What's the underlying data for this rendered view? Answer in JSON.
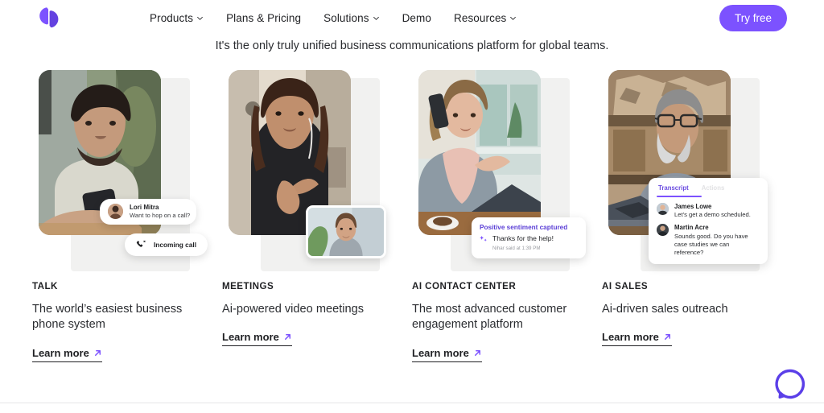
{
  "header": {
    "logo_name": "dialpad-logo",
    "nav": [
      {
        "label": "Products",
        "has_chevron": true
      },
      {
        "label": "Plans & Pricing",
        "has_chevron": false
      },
      {
        "label": "Solutions",
        "has_chevron": true
      },
      {
        "label": "Demo",
        "has_chevron": false
      },
      {
        "label": "Resources",
        "has_chevron": true
      }
    ],
    "cta_label": "Try free",
    "cta_color": "#7c52ff"
  },
  "tagline": "It's the only truly unified business communications platform for global teams.",
  "cards": [
    {
      "eyebrow": "TALK",
      "description": "The world’s easiest business phone system",
      "link_label": "Learn more",
      "overlay": {
        "message_name": "Lori Mitra",
        "message_text": "Want to hop on a call?",
        "call_label": "Incoming call"
      }
    },
    {
      "eyebrow": "MEETINGS",
      "description": "Ai-powered video meetings",
      "link_label": "Learn more",
      "overlay": {}
    },
    {
      "eyebrow": "AI CONTACT CENTER",
      "description": "The most advanced customer engagement platform",
      "link_label": "Learn more",
      "overlay": {
        "sentiment_title": "Positive sentiment captured",
        "sentiment_message": "Thanks for the help!",
        "sentiment_meta": "Nihar said at 1:39 PM"
      }
    },
    {
      "eyebrow": "AI SALES",
      "description": "Ai-driven sales outreach",
      "link_label": "Learn more",
      "overlay": {
        "tab_active": "Transcript",
        "tab_inactive": "Actions",
        "messages": [
          {
            "name": "James Lowe",
            "text": "Let’s get a demo scheduled."
          },
          {
            "name": "Martin Acre",
            "text": "Sounds good. Do you have case studies we can reference?"
          }
        ]
      }
    }
  ],
  "chat_widget": {
    "name": "chat-launcher",
    "color": "#5b3fe8"
  }
}
